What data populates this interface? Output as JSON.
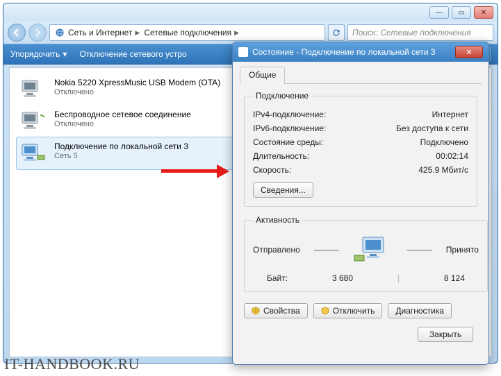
{
  "window": {
    "breadcrumb": {
      "root": "Сеть и Интернет",
      "current": "Сетевые подключения"
    },
    "search_placeholder": "Поиск: Сетевые подключения",
    "toolbar": {
      "organize": "Упорядочить",
      "disable": "Отключение сетевого устро"
    }
  },
  "list": {
    "items": [
      {
        "title": "Nokia 5220 XpressMusic USB Modem (OTA)",
        "sub": "Отключено",
        "selected": false,
        "disabled": true
      },
      {
        "title": "Беспроводное сетевое соединение",
        "sub": "Отключено",
        "selected": false,
        "disabled": true
      },
      {
        "title": "Подключение по локальной сети 3",
        "sub": "Сеть 5",
        "selected": true,
        "disabled": false
      }
    ]
  },
  "dialog": {
    "title": "Состояние - Подключение по локальной сети 3",
    "tab": "Общие",
    "group_connection": "Подключение",
    "rows": {
      "ipv4_k": "IPv4-подключение:",
      "ipv4_v": "Интернет",
      "ipv6_k": "IPv6-подключение:",
      "ipv6_v": "Без доступа к сети",
      "media_k": "Состояние среды:",
      "media_v": "Подключено",
      "dur_k": "Длительность:",
      "dur_v": "00:02:14",
      "speed_k": "Скорость:",
      "speed_v": "425.9 Мбит/с"
    },
    "btn_details": "Сведения...",
    "group_activity": "Активность",
    "sent_label": "Отправлено",
    "recv_label": "Принято",
    "bytes_label": "Байт:",
    "bytes_sent": "3 680",
    "bytes_recv": "8 124",
    "btn_props": "Свойства",
    "btn_disable": "Отключить",
    "btn_diag": "Диагностика",
    "btn_close": "Закрыть"
  },
  "watermark": "IT-HANDBOOK.RU"
}
